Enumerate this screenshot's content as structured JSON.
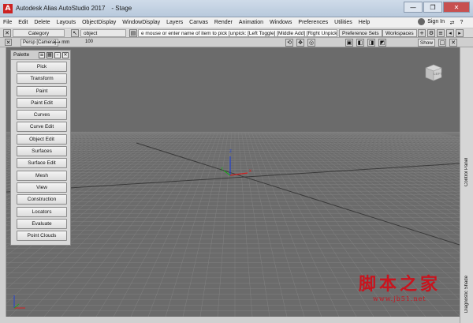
{
  "window": {
    "app_icon": "A",
    "title": "Autodesk Alias AutoStudio 2017",
    "subtitle": "- Stage",
    "controls": [
      "—",
      "❐",
      "✕"
    ]
  },
  "menu": {
    "items": [
      "File",
      "Edit",
      "Delete",
      "Layouts",
      "ObjectDisplay",
      "WindowDisplay",
      "Layers",
      "Canvas",
      "Render",
      "Animation",
      "Windows",
      "Preferences",
      "Utilities",
      "Help"
    ],
    "signin": "Sign In"
  },
  "toolbar": {
    "category": "Category",
    "object_field": "object",
    "prompt": "e mouse or enter name of item to pick [unpick: [Left Toggle] [Middle Add] [Right Unpick",
    "preference_sets": "Preference Sets",
    "workspaces": "Workspaces"
  },
  "viewbar": {
    "camera": "Persp [Camera]",
    "units": "⟷ mm",
    "zoom": "100",
    "show": "Show"
  },
  "viewcube": {
    "face": "LEFT"
  },
  "axes": {
    "x": "x",
    "y": "y",
    "z": "z"
  },
  "palette": {
    "title": "Palette",
    "items": [
      "Pick",
      "Transform",
      "Paint",
      "Paint Edit",
      "Curves",
      "Curve Edit",
      "Object Edit",
      "Surfaces",
      "Surface Edit",
      "Mesh",
      "View",
      "Construction",
      "Locators",
      "Evaluate",
      "Point Clouds"
    ]
  },
  "right_panel": {
    "control_panel": "Control Panel",
    "diagnostic_shade": "Diagnostic Shade"
  },
  "watermark": {
    "cn": "脚本之家",
    "url": "www.jb51.net"
  },
  "colors": {
    "viewport_bg": "#6b6b6b",
    "grid": "#828282",
    "axis_x": "#d02020",
    "axis_y": "#20a020",
    "axis_z": "#2040d0"
  }
}
